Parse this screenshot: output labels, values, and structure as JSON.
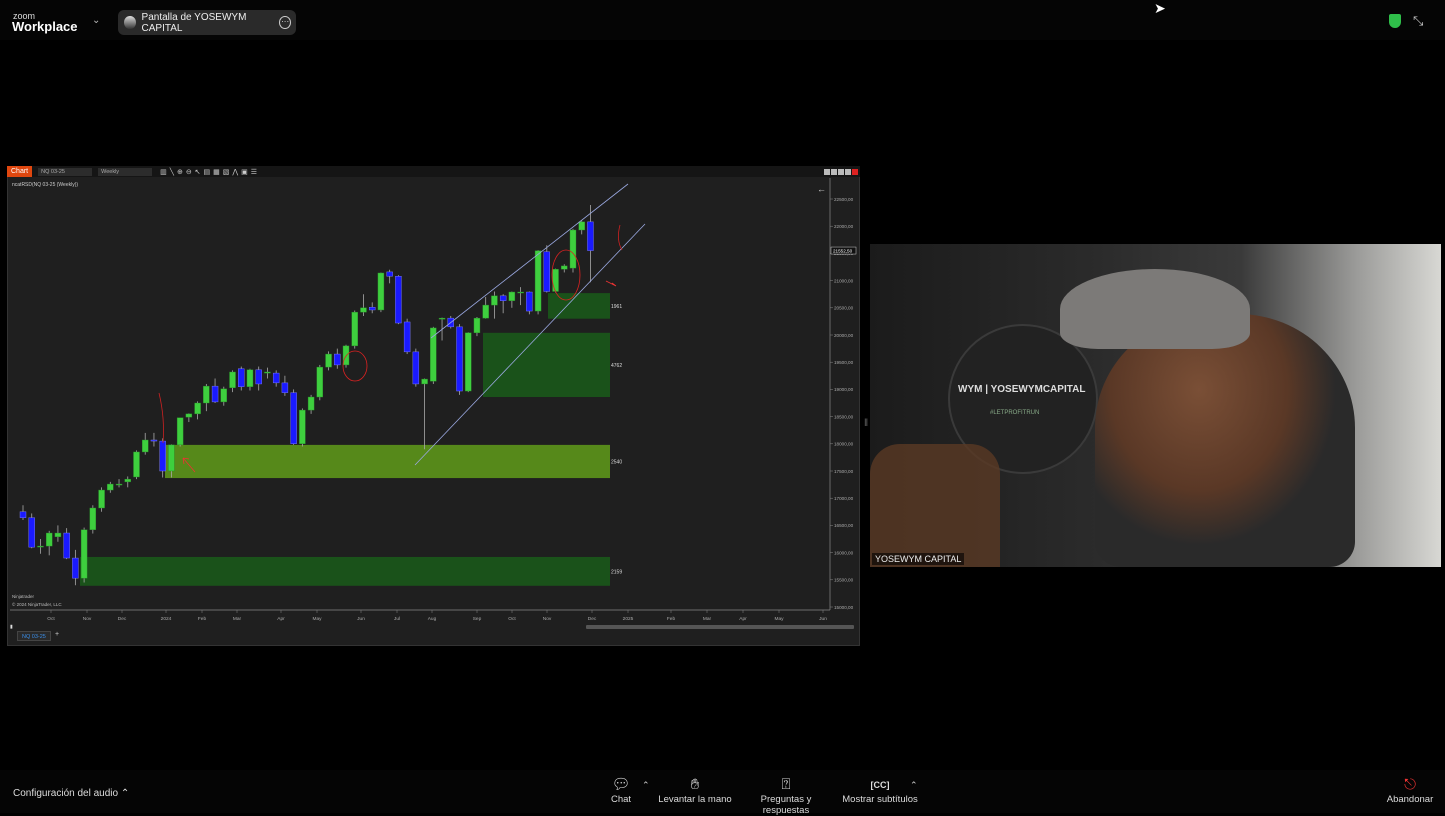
{
  "app": {
    "logo_small": "zoom",
    "logo_big": "Workplace",
    "share_label": "Pantalla de YOSEWYM CAPITAL"
  },
  "chart": {
    "tab": "Chart",
    "instrument": "NQ 03-25",
    "period": "Weekly",
    "subtitle": "ncatRSD(NQ 03-25 (Weekly))",
    "watermark": "Ninjatrader",
    "copyright": "© 2024 NinjaTrader, LLC",
    "sheet_tab": "NQ 03-25",
    "sheet_add": "+",
    "colors": {
      "up": "#3ecf3e",
      "down": "#1a1aff",
      "zone_dark": "#1a5c1a",
      "zone_olive": "#5a8f1a",
      "background": "#1f1f1f"
    }
  },
  "chart_data": {
    "type": "candlestick",
    "ylim": [
      15000,
      22500
    ],
    "y_ticks": [
      "22500,00",
      "22000,00",
      "21500,00",
      "21000,00",
      "20500,00",
      "20000,00",
      "19500,00",
      "19000,00",
      "18500,00",
      "18000,00",
      "17500,00",
      "17000,00",
      "16500,00",
      "16000,00",
      "15500,00",
      "15000,00"
    ],
    "x_ticks": [
      "Oct",
      "Nov",
      "Dec",
      "2024",
      "Feb",
      "Mar",
      "Apr",
      "May",
      "Jun",
      "Jul",
      "Aug",
      "Sep",
      "Oct",
      "Nov",
      "Dec",
      "2025",
      "Feb",
      "Mar",
      "Apr",
      "May",
      "Jun"
    ],
    "last_price": "21552,50",
    "candles": [
      [
        16750,
        16870,
        16600,
        16640
      ],
      [
        16640,
        16720,
        16080,
        16100
      ],
      [
        16120,
        16250,
        15980,
        16120
      ],
      [
        16120,
        16400,
        15950,
        16360
      ],
      [
        16290,
        16500,
        16200,
        16360
      ],
      [
        16360,
        16450,
        15880,
        15900
      ],
      [
        15900,
        16050,
        15400,
        15530
      ],
      [
        15530,
        16460,
        15450,
        16420
      ],
      [
        16420,
        16870,
        16350,
        16820
      ],
      [
        16820,
        17200,
        16750,
        17150
      ],
      [
        17150,
        17300,
        17100,
        17260
      ],
      [
        17260,
        17350,
        17200,
        17260
      ],
      [
        17300,
        17400,
        17200,
        17350
      ],
      [
        17390,
        17880,
        17350,
        17850
      ],
      [
        17850,
        18200,
        17800,
        18070
      ],
      [
        18070,
        18200,
        17950,
        18050
      ],
      [
        18050,
        18100,
        17380,
        17500
      ],
      [
        17500,
        17990,
        17380,
        17980
      ],
      [
        17980,
        18480,
        17950,
        18480
      ],
      [
        18490,
        18560,
        18400,
        18550
      ],
      [
        18550,
        18780,
        18450,
        18750
      ],
      [
        18750,
        19100,
        18600,
        19060
      ],
      [
        19060,
        19200,
        18750,
        18770
      ],
      [
        18770,
        19050,
        18700,
        19010
      ],
      [
        19030,
        19350,
        18950,
        19320
      ],
      [
        19380,
        19420,
        18980,
        19050
      ],
      [
        19050,
        19380,
        18980,
        19360
      ],
      [
        19360,
        19420,
        18980,
        19100
      ],
      [
        19300,
        19400,
        19200,
        19320
      ],
      [
        19300,
        19350,
        19050,
        19120
      ],
      [
        19120,
        19250,
        18880,
        18940
      ],
      [
        18940,
        19000,
        17980,
        18000
      ],
      [
        18000,
        18650,
        17950,
        18620
      ],
      [
        18620,
        18900,
        18550,
        18860
      ],
      [
        18860,
        19450,
        18800,
        19410
      ],
      [
        19410,
        19700,
        19350,
        19650
      ],
      [
        19650,
        19750,
        19380,
        19450
      ],
      [
        19450,
        19820,
        19400,
        19800
      ],
      [
        19800,
        20450,
        19750,
        20420
      ],
      [
        20420,
        20750,
        20350,
        20500
      ],
      [
        20510,
        20600,
        20400,
        20460
      ],
      [
        20460,
        21150,
        20420,
        21140
      ],
      [
        21160,
        21200,
        20950,
        21080
      ],
      [
        21080,
        21100,
        20200,
        20220
      ],
      [
        20240,
        20300,
        19650,
        19690
      ],
      [
        19690,
        19750,
        19050,
        19100
      ],
      [
        19100,
        19200,
        17900,
        19190
      ],
      [
        19150,
        20150,
        19100,
        20130
      ],
      [
        20290,
        20320,
        19900,
        20310
      ],
      [
        20310,
        20350,
        20120,
        20150
      ],
      [
        20150,
        20200,
        18900,
        18970
      ],
      [
        18970,
        20050,
        18950,
        20040
      ],
      [
        20040,
        20330,
        19980,
        20310
      ],
      [
        20310,
        20700,
        20300,
        20550
      ],
      [
        20550,
        20800,
        20300,
        20720
      ],
      [
        20720,
        20750,
        20400,
        20630
      ],
      [
        20630,
        20800,
        20500,
        20790
      ],
      [
        20790,
        20880,
        20550,
        20790
      ],
      [
        20790,
        20800,
        20380,
        20440
      ],
      [
        20440,
        21560,
        20380,
        21550
      ],
      [
        21530,
        21650,
        20780,
        20800
      ],
      [
        20800,
        21220,
        20780,
        21210
      ],
      [
        21210,
        21300,
        21150,
        21270
      ],
      [
        21230,
        21950,
        21150,
        21930
      ],
      [
        21930,
        22100,
        21850,
        22080
      ],
      [
        22080,
        22390,
        20970,
        21552
      ]
    ],
    "zones": [
      {
        "label": "1961",
        "top": 20770,
        "bottom": 20300,
        "color": "dark"
      },
      {
        "label": "4762",
        "top": 20040,
        "bottom": 18860,
        "color": "dark"
      },
      {
        "label": "2540",
        "top": 17980,
        "bottom": 17370,
        "color": "olive"
      },
      {
        "label": "2159",
        "top": 15920,
        "bottom": 15390,
        "color": "dark"
      }
    ]
  },
  "webcam": {
    "participant_name": "YOSEWYM CAPITAL",
    "wall_logo": "WYM | YOSEWYMCAPITAL",
    "wall_tag": "#LETPROFITRUN"
  },
  "bottom": {
    "audio": "Configuración del audio",
    "chat": "Chat",
    "raise_hand": "Levantar la mano",
    "qa": "Preguntas y respuestas",
    "captions": "Mostrar subtítulos",
    "leave": "Abandonar"
  }
}
